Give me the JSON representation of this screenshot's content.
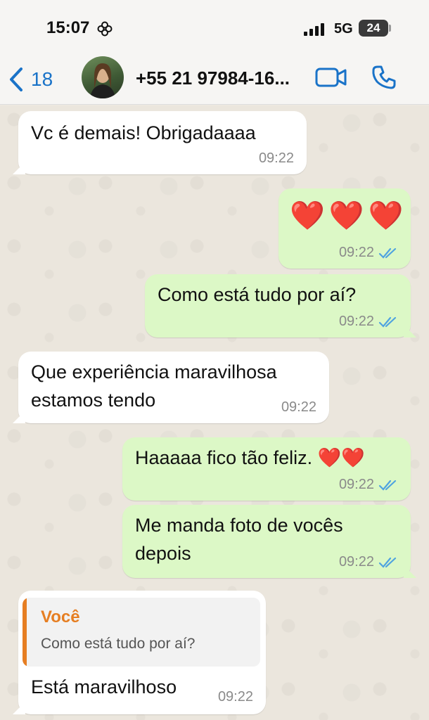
{
  "status_bar": {
    "time": "15:07",
    "network": "5G",
    "battery": "24",
    "icons": [
      "flower-icon",
      "signal-icon"
    ]
  },
  "header": {
    "back_count": "18",
    "contact_name": "+55 21 97984-16...",
    "icons": [
      "chevron-left-icon",
      "video-call-icon",
      "phone-icon"
    ],
    "accent_color": "#1a73c8"
  },
  "messages": [
    {
      "direction": "incoming",
      "text": "Vc é demais! Obrigadaaaa",
      "time": "09:22"
    },
    {
      "direction": "outgoing",
      "text": "❤️❤️❤️",
      "time": "09:22",
      "read": true
    },
    {
      "direction": "outgoing",
      "text": "Como está tudo por aí?",
      "time": "09:22",
      "read": true
    },
    {
      "direction": "incoming",
      "text_line1": "Que experiência maravilhosa",
      "text_line2": "estamos tendo",
      "time": "09:22"
    },
    {
      "direction": "outgoing",
      "text": "Haaaaa fico tão feliz.",
      "emoji": "❤️❤️",
      "time": "09:22",
      "read": true
    },
    {
      "direction": "outgoing",
      "text_line1": "Me manda foto de vocês",
      "text_line2": "depois",
      "time": "09:22",
      "read": true
    },
    {
      "direction": "incoming",
      "reply": {
        "author": "Você",
        "text": "Como está tudo por aí?"
      },
      "text": "Está maravilhoso",
      "time": "09:22"
    }
  ],
  "colors": {
    "outgoing_bubble": "#dcf8c6",
    "incoming_bubble": "#ffffff",
    "read_ticks": "#4fa3e0",
    "reply_accent": "#e67e22"
  }
}
